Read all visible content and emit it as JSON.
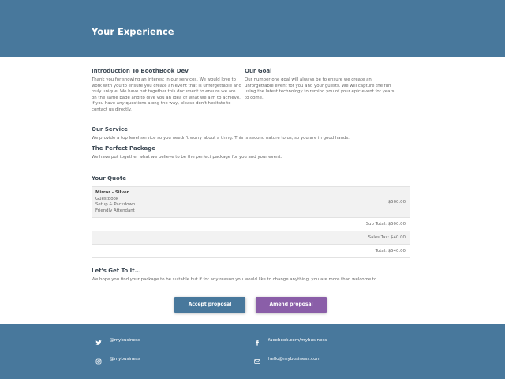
{
  "header": {
    "title": "Your Experience"
  },
  "intro": {
    "title": "Introduction To BoothBook Dev",
    "lines": [
      "Thank you for showing an interest in our services. We would love to",
      "work with you to ensure you create an event that is unforgettable and",
      "truly unique. We have put together this document to ensure we are",
      "on the same page and to give you an idea of what we aim to achieve.",
      "If you have any questions along the way, please don't hesitate to",
      "contact us directly."
    ]
  },
  "goal": {
    "title": "Our Goal",
    "lines": [
      "Our number one goal will always be to ensure we create an",
      "unforgettable event for you and your guests. We will capture the fun",
      "using the latest technology to remind you of your epic event for years",
      "to come."
    ]
  },
  "service": {
    "title": "Our Service",
    "text": "We provide a top level service so you needn't worry about a thing. This is second nature to us, so you are in good hands."
  },
  "package": {
    "title": "The Perfect Package",
    "text": "We have put together what we believe to be the perfect package for you and your event."
  },
  "quote": {
    "title": "Your Quote",
    "item": {
      "name": "Mirror - Silver",
      "lines": [
        "Guestbook",
        "Setup & Packdown",
        "Friendly Attendant"
      ],
      "price": "$500.00"
    },
    "subtotal": "Sub Total: $500.00",
    "tax": "Sales Tax: $40.00",
    "total": "Total: $540.00"
  },
  "closing": {
    "title": "Let's Get To It...",
    "text": "We hope you find your package to be suitable but if for any reason you would like to change anything, you are more than welcome to."
  },
  "buttons": {
    "accept": "Accept proposal",
    "amend": "Amend proposal"
  },
  "footer": {
    "twitter": "@mybusiness",
    "facebook": "facebook.com/mybusiness",
    "instagram": "@mybusiness",
    "email": "hello@mybusiness.com"
  },
  "colors": {
    "brand": "#48789c",
    "amend": "#8a5ea8"
  }
}
